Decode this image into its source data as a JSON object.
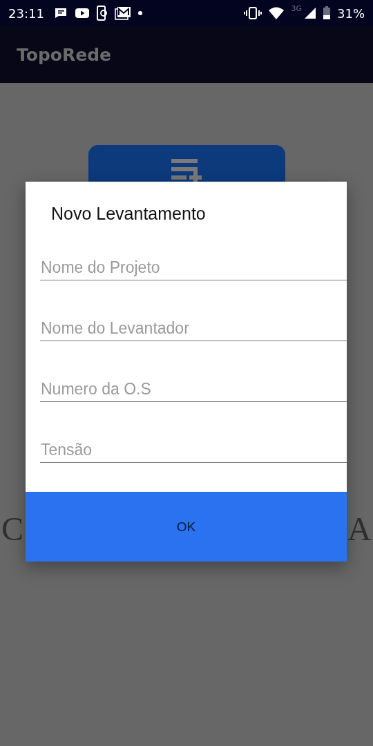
{
  "status_bar": {
    "time": "23:11",
    "network": "3G",
    "battery": "31%"
  },
  "app_bar": {
    "title": "TopoRede"
  },
  "background": {
    "left_letter": "C",
    "right_letter": "A"
  },
  "dialog": {
    "title": "Novo Levantamento",
    "fields": [
      {
        "placeholder": "Nome do Projeto"
      },
      {
        "placeholder": "Nome do Levantador"
      },
      {
        "placeholder": "Numero da O.S"
      },
      {
        "placeholder": "Tensão"
      }
    ],
    "button": "OK"
  }
}
